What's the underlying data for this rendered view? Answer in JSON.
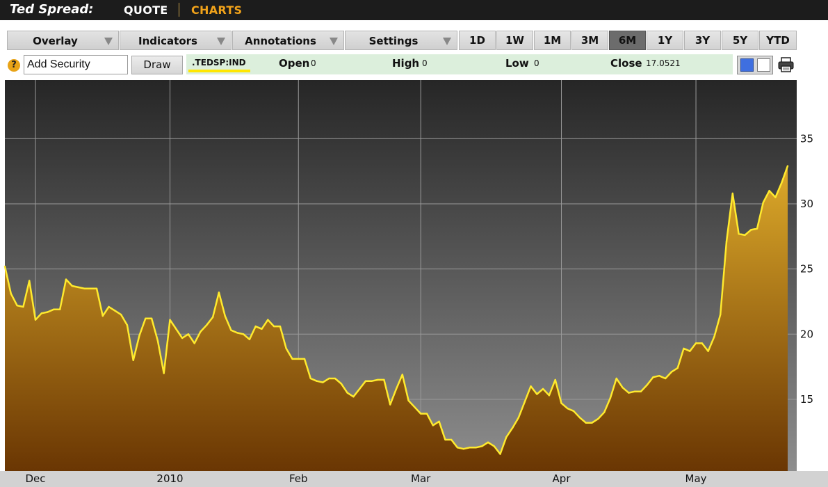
{
  "header": {
    "title": "Ted Spread:",
    "nav": {
      "quote": "QUOTE",
      "charts": "CHARTS"
    }
  },
  "toolbar": {
    "dropdowns": [
      "Overlay",
      "Indicators",
      "Annotations",
      "Settings"
    ],
    "ranges": [
      "1D",
      "1W",
      "1M",
      "3M",
      "6M",
      "1Y",
      "3Y",
      "5Y",
      "YTD"
    ],
    "active_range": "6M"
  },
  "security": {
    "help_icon": "?",
    "add_value": "Add Security",
    "draw_label": "Draw"
  },
  "quote": {
    "symbol": ".TEDSP:IND",
    "open_label": "Open",
    "open": "0",
    "high_label": "High",
    "high": "0",
    "low_label": "Low",
    "low": "0",
    "close_label": "Close",
    "close": "17.0521"
  },
  "icons": {
    "color_toggle": "color-swatch-icon",
    "print": "printer-icon",
    "help": "help-icon"
  },
  "colors": {
    "line": "#ffea2e",
    "area_top": "#ddaa2a",
    "area_bottom": "#6a3603",
    "accent": "#f0a21a"
  },
  "chart_data": {
    "type": "area",
    "title": "",
    "xlabel": "",
    "ylabel": "",
    "series_color": "#ffea2e",
    "ylim": [
      9.5,
      39.5
    ],
    "yticks": [
      15,
      20,
      25,
      30,
      35
    ],
    "x_axis_labels": [
      "Dec",
      "2010",
      "Feb",
      "Mar",
      "Apr",
      "May"
    ],
    "grid": true,
    "points": [
      {
        "x": "2009-11-24",
        "y": 25.2
      },
      {
        "x": "2009-11-25",
        "y": 23.1
      },
      {
        "x": "2009-11-26",
        "y": 22.2
      },
      {
        "x": "2009-11-27",
        "y": 22.1
      },
      {
        "x": "2009-11-30",
        "y": 24.1
      },
      {
        "x": "2009-12-01",
        "y": 21.1
      },
      {
        "x": "2009-12-02",
        "y": 21.6
      },
      {
        "x": "2009-12-03",
        "y": 21.7
      },
      {
        "x": "2009-12-04",
        "y": 21.9
      },
      {
        "x": "2009-12-07",
        "y": 21.9
      },
      {
        "x": "2009-12-08",
        "y": 24.2
      },
      {
        "x": "2009-12-09",
        "y": 23.7
      },
      {
        "x": "2009-12-10",
        "y": 23.6
      },
      {
        "x": "2009-12-11",
        "y": 23.5
      },
      {
        "x": "2009-12-14",
        "y": 23.5
      },
      {
        "x": "2009-12-15",
        "y": 23.5
      },
      {
        "x": "2009-12-16",
        "y": 21.4
      },
      {
        "x": "2009-12-17",
        "y": 22.1
      },
      {
        "x": "2009-12-18",
        "y": 21.8
      },
      {
        "x": "2009-12-21",
        "y": 21.5
      },
      {
        "x": "2009-12-22",
        "y": 20.7
      },
      {
        "x": "2009-12-23",
        "y": 18.0
      },
      {
        "x": "2009-12-24",
        "y": 19.9
      },
      {
        "x": "2009-12-28",
        "y": 21.2
      },
      {
        "x": "2009-12-29",
        "y": 21.2
      },
      {
        "x": "2009-12-30",
        "y": 19.5
      },
      {
        "x": "2009-12-31",
        "y": 17.0
      },
      {
        "x": "2010-01-01",
        "y": 21.1
      },
      {
        "x": "2010-01-04",
        "y": 20.4
      },
      {
        "x": "2010-01-05",
        "y": 19.7
      },
      {
        "x": "2010-01-06",
        "y": 20.0
      },
      {
        "x": "2010-01-07",
        "y": 19.3
      },
      {
        "x": "2010-01-08",
        "y": 20.2
      },
      {
        "x": "2010-01-11",
        "y": 20.7
      },
      {
        "x": "2010-01-12",
        "y": 21.3
      },
      {
        "x": "2010-01-13",
        "y": 23.2
      },
      {
        "x": "2010-01-14",
        "y": 21.4
      },
      {
        "x": "2010-01-15",
        "y": 20.3
      },
      {
        "x": "2010-01-18",
        "y": 20.1
      },
      {
        "x": "2010-01-19",
        "y": 20.0
      },
      {
        "x": "2010-01-20",
        "y": 19.6
      },
      {
        "x": "2010-01-21",
        "y": 20.6
      },
      {
        "x": "2010-01-22",
        "y": 20.4
      },
      {
        "x": "2010-01-25",
        "y": 21.1
      },
      {
        "x": "2010-01-26",
        "y": 20.6
      },
      {
        "x": "2010-01-27",
        "y": 20.6
      },
      {
        "x": "2010-01-28",
        "y": 18.9
      },
      {
        "x": "2010-01-29",
        "y": 18.1
      },
      {
        "x": "2010-02-01",
        "y": 18.1
      },
      {
        "x": "2010-02-02",
        "y": 18.1
      },
      {
        "x": "2010-02-03",
        "y": 16.6
      },
      {
        "x": "2010-02-04",
        "y": 16.4
      },
      {
        "x": "2010-02-05",
        "y": 16.3
      },
      {
        "x": "2010-02-08",
        "y": 16.6
      },
      {
        "x": "2010-02-09",
        "y": 16.6
      },
      {
        "x": "2010-02-10",
        "y": 16.2
      },
      {
        "x": "2010-02-11",
        "y": 15.5
      },
      {
        "x": "2010-02-12",
        "y": 15.2
      },
      {
        "x": "2010-02-15",
        "y": 15.8
      },
      {
        "x": "2010-02-16",
        "y": 16.4
      },
      {
        "x": "2010-02-17",
        "y": 16.4
      },
      {
        "x": "2010-02-18",
        "y": 16.5
      },
      {
        "x": "2010-02-19",
        "y": 16.5
      },
      {
        "x": "2010-02-22",
        "y": 14.6
      },
      {
        "x": "2010-02-23",
        "y": 15.8
      },
      {
        "x": "2010-02-24",
        "y": 16.9
      },
      {
        "x": "2010-02-25",
        "y": 14.9
      },
      {
        "x": "2010-02-26",
        "y": 14.4
      },
      {
        "x": "2010-03-01",
        "y": 13.9
      },
      {
        "x": "2010-03-02",
        "y": 13.9
      },
      {
        "x": "2010-03-03",
        "y": 13.0
      },
      {
        "x": "2010-03-04",
        "y": 13.3
      },
      {
        "x": "2010-03-05",
        "y": 11.9
      },
      {
        "x": "2010-03-08",
        "y": 11.9
      },
      {
        "x": "2010-03-09",
        "y": 11.3
      },
      {
        "x": "2010-03-10",
        "y": 11.2
      },
      {
        "x": "2010-03-11",
        "y": 11.3
      },
      {
        "x": "2010-03-12",
        "y": 11.3
      },
      {
        "x": "2010-03-15",
        "y": 11.4
      },
      {
        "x": "2010-03-16",
        "y": 11.7
      },
      {
        "x": "2010-03-17",
        "y": 11.4
      },
      {
        "x": "2010-03-18",
        "y": 10.8
      },
      {
        "x": "2010-03-19",
        "y": 12.1
      },
      {
        "x": "2010-03-22",
        "y": 12.8
      },
      {
        "x": "2010-03-23",
        "y": 13.6
      },
      {
        "x": "2010-03-24",
        "y": 14.8
      },
      {
        "x": "2010-03-25",
        "y": 16.0
      },
      {
        "x": "2010-03-26",
        "y": 15.4
      },
      {
        "x": "2010-03-29",
        "y": 15.8
      },
      {
        "x": "2010-03-30",
        "y": 15.3
      },
      {
        "x": "2010-03-31",
        "y": 16.5
      },
      {
        "x": "2010-04-01",
        "y": 14.7
      },
      {
        "x": "2010-04-02",
        "y": 14.3
      },
      {
        "x": "2010-04-05",
        "y": 14.1
      },
      {
        "x": "2010-04-06",
        "y": 13.6
      },
      {
        "x": "2010-04-07",
        "y": 13.2
      },
      {
        "x": "2010-04-08",
        "y": 13.2
      },
      {
        "x": "2010-04-09",
        "y": 13.5
      },
      {
        "x": "2010-04-12",
        "y": 14.0
      },
      {
        "x": "2010-04-13",
        "y": 15.1
      },
      {
        "x": "2010-04-14",
        "y": 16.6
      },
      {
        "x": "2010-04-15",
        "y": 15.9
      },
      {
        "x": "2010-04-16",
        "y": 15.5
      },
      {
        "x": "2010-04-19",
        "y": 15.6
      },
      {
        "x": "2010-04-20",
        "y": 15.6
      },
      {
        "x": "2010-04-21",
        "y": 16.1
      },
      {
        "x": "2010-04-22",
        "y": 16.7
      },
      {
        "x": "2010-04-23",
        "y": 16.8
      },
      {
        "x": "2010-04-26",
        "y": 16.6
      },
      {
        "x": "2010-04-27",
        "y": 17.1
      },
      {
        "x": "2010-04-28",
        "y": 17.4
      },
      {
        "x": "2010-04-29",
        "y": 18.9
      },
      {
        "x": "2010-04-30",
        "y": 18.7
      },
      {
        "x": "2010-05-03",
        "y": 19.3
      },
      {
        "x": "2010-05-04",
        "y": 19.3
      },
      {
        "x": "2010-05-05",
        "y": 18.7
      },
      {
        "x": "2010-05-06",
        "y": 19.8
      },
      {
        "x": "2010-05-07",
        "y": 21.5
      },
      {
        "x": "2010-05-10",
        "y": 27.1
      },
      {
        "x": "2010-05-11",
        "y": 30.8
      },
      {
        "x": "2010-05-12",
        "y": 27.7
      },
      {
        "x": "2010-05-13",
        "y": 27.6
      },
      {
        "x": "2010-05-14",
        "y": 28.0
      },
      {
        "x": "2010-05-17",
        "y": 28.1
      },
      {
        "x": "2010-05-18",
        "y": 30.1
      },
      {
        "x": "2010-05-19",
        "y": 31.0
      },
      {
        "x": "2010-05-20",
        "y": 30.5
      },
      {
        "x": "2010-05-21",
        "y": 31.6
      },
      {
        "x": "2010-05-24",
        "y": 32.9
      }
    ]
  }
}
